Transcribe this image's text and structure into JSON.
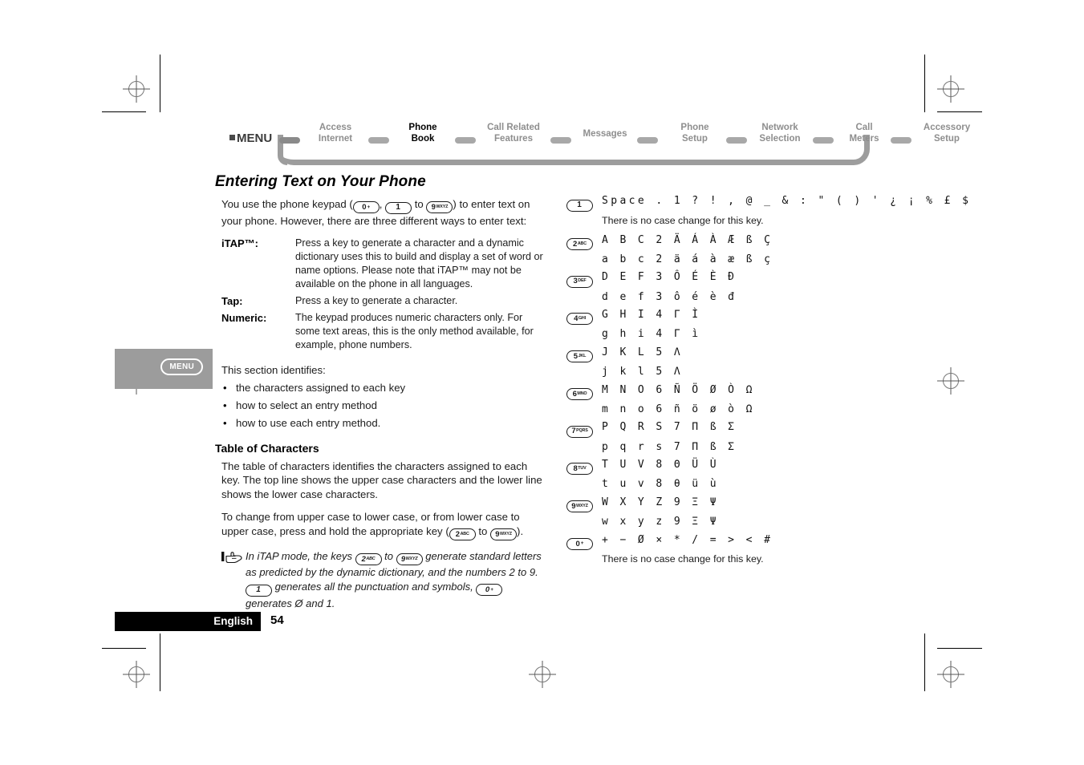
{
  "nav": {
    "menu_label": "MENU",
    "items": [
      {
        "label": "Access\nInternet",
        "line1": "Access",
        "line2": "Internet",
        "active": false
      },
      {
        "label": "Phone Book",
        "line1": "Phone",
        "line2": "Book",
        "active": true
      },
      {
        "label": "Call Related Features",
        "line1": "Call Related",
        "line2": "Features",
        "active": false
      },
      {
        "label": "Messages",
        "line1": "Messages",
        "line2": "",
        "active": false
      },
      {
        "label": "Phone Setup",
        "line1": "Phone",
        "line2": "Setup",
        "active": false
      },
      {
        "label": "Network Selection",
        "line1": "Network",
        "line2": "Selection",
        "active": false
      },
      {
        "label": "Call Meters",
        "line1": "Call",
        "line2": "Meters",
        "active": false
      },
      {
        "label": "Accessory Setup",
        "line1": "Accessory",
        "line2": "Setup",
        "active": false
      }
    ]
  },
  "section": {
    "title": "Entering Text on Your Phone",
    "intro_a": "You use the phone keypad (",
    "intro_b": ", ",
    "intro_c": " to ",
    "intro_d": ") to enter text on your phone. However, there are three different ways to enter text:",
    "definitions": [
      {
        "term": "iTAP™:",
        "desc": "Press a key to generate a character and a dynamic dictionary uses this to build and display a set of word or name options. Please note that iTAP™ may not be available on the phone in all languages."
      },
      {
        "term": "Tap:",
        "desc": "Press a key to generate a character."
      },
      {
        "term": "Numeric:",
        "desc": "The keypad produces numeric characters only. For some text areas, this is the only method available, for example, phone numbers."
      }
    ],
    "identifies_lead": "This section identifies:",
    "bullets": [
      "the characters assigned to each key",
      "how to select an entry method",
      "how to use each entry method."
    ],
    "table_heading": "Table of Characters",
    "table_intro": "The table of characters identifies the characters assigned to each key. The top line shows the upper case characters and the lower line shows the lower case characters.",
    "case_change_a": "To change from upper case to lower case, or from lower case to upper case, press and hold the appropriate key (",
    "case_change_b": " to ",
    "case_change_c": ").",
    "note_a": "In iTAP mode, the keys ",
    "note_b": " to ",
    "note_c": " generate standard letters as predicted by the dynamic dictionary, and the numbers 2 to 9. ",
    "note_d": " generates all the punctuation and symbols, ",
    "note_e": " generates Ø and 1."
  },
  "keys": {
    "k0": {
      "num": "0",
      "sub": "+"
    },
    "k1": {
      "num": "1",
      "sub": ""
    },
    "k2": {
      "num": "2",
      "sub": "ABC"
    },
    "k3": {
      "num": "3",
      "sub": "DEF"
    },
    "k4": {
      "num": "4",
      "sub": "GHI"
    },
    "k5": {
      "num": "5",
      "sub": "JKL"
    },
    "k6": {
      "num": "6",
      "sub": "MNO"
    },
    "k7": {
      "num": "7",
      "sub": "PQRS"
    },
    "k8": {
      "num": "8",
      "sub": "TUV"
    },
    "k9": {
      "num": "9",
      "sub": "WXYZ"
    }
  },
  "char_table": {
    "no_case_change": "There is no case change for this key.",
    "rows": [
      {
        "key": "1",
        "sub": "",
        "upper": "Space . 1 ? ! , @ _ & : \" ( ) ' ¿ ¡ % £ $",
        "lower": "",
        "note": "There is no case change for this key."
      },
      {
        "key": "2",
        "sub": "ABC",
        "upper": "A B C 2 Ä Á À Æ ß Ç",
        "lower": "a b c 2 ä á à æ ß ç",
        "note": ""
      },
      {
        "key": "3",
        "sub": "DEF",
        "upper": "D E F 3 Ô É È Đ",
        "lower": "d e f 3 ô é è đ",
        "note": ""
      },
      {
        "key": "4",
        "sub": "GHI",
        "upper": "G H I 4 Γ Ì",
        "lower": "g h i 4 Γ ì",
        "note": ""
      },
      {
        "key": "5",
        "sub": "JKL",
        "upper": "J K L 5 Λ",
        "lower": "j k l 5 Λ",
        "note": ""
      },
      {
        "key": "6",
        "sub": "MNO",
        "upper": "M N O 6 Ñ Ö Ø Ò Ω",
        "lower": "m n o 6 ñ ö ø ò Ω",
        "note": ""
      },
      {
        "key": "7",
        "sub": "PQRS",
        "upper": "P Q R S 7 Π ß Σ",
        "lower": "p q r s 7 Π ß Σ",
        "note": ""
      },
      {
        "key": "8",
        "sub": "TUV",
        "upper": "T U V 8 Θ Ü Ù",
        "lower": "t u v 8 θ ü ù",
        "note": ""
      },
      {
        "key": "9",
        "sub": "WXYZ",
        "upper": "W X Y Z 9 Ξ Ψ",
        "lower": "w x y z 9 Ξ Ψ",
        "note": ""
      },
      {
        "key": "0",
        "sub": "+",
        "upper": "+ − Ø × * / = > < #",
        "lower": "",
        "note": "There is no case change for this key."
      }
    ]
  },
  "margin_tab": {
    "button_label": "MENU"
  },
  "footer": {
    "language": "English",
    "page_number": "54"
  },
  "colors": {
    "nav_inactive": "#8e8e8e",
    "nav_track": "#9d9d9d",
    "margin_tab": "#9c9c9c",
    "footer_bar": "#000000"
  }
}
